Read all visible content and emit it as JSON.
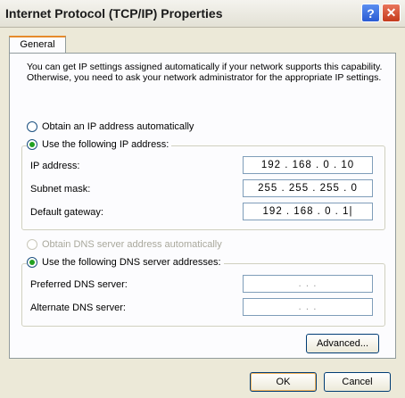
{
  "window": {
    "title": "Internet Protocol (TCP/IP) Properties",
    "help_label": "?",
    "close_label": "✕"
  },
  "tabs": [
    {
      "label": "General"
    }
  ],
  "description": "You can get IP settings assigned automatically if your network supports this capability. Otherwise, you need to ask your network administrator for the appropriate IP settings.",
  "ip_section": {
    "auto_option": "Obtain an IP address automatically",
    "manual_option": "Use the following IP address:",
    "selected": "manual",
    "fields": [
      {
        "label": "IP address:",
        "value": "192 . 168 .  0  . 10"
      },
      {
        "label": "Subnet mask:",
        "value": "255 . 255 . 255 .  0"
      },
      {
        "label": "Default gateway:",
        "value": "192 . 168 .  0  .  1|"
      }
    ]
  },
  "dns_section": {
    "auto_option": "Obtain DNS server address automatically",
    "manual_option": "Use the following DNS server addresses:",
    "selected": "manual",
    "fields": [
      {
        "label": "Preferred DNS server:",
        "value": ".       .       ."
      },
      {
        "label": "Alternate DNS server:",
        "value": ".       .       ."
      }
    ]
  },
  "buttons": {
    "advanced": "Advanced...",
    "ok": "OK",
    "cancel": "Cancel"
  }
}
